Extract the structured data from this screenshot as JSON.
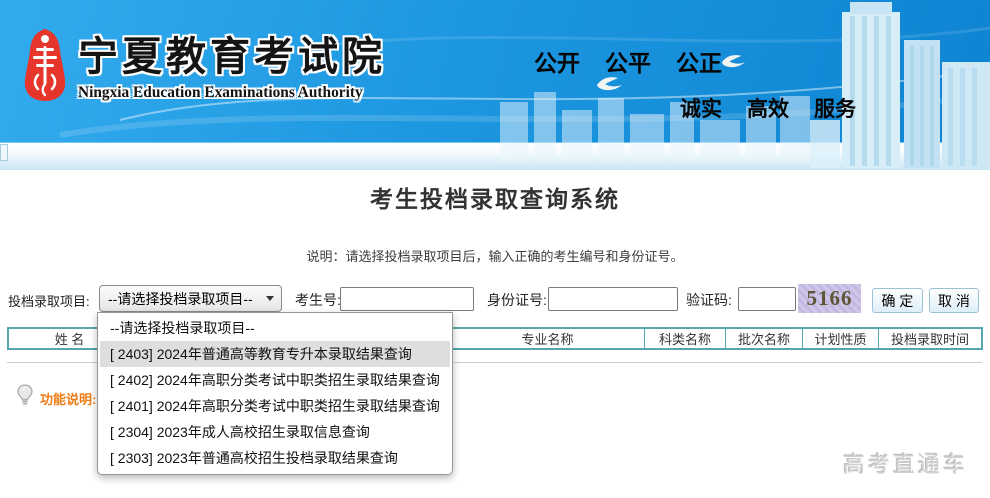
{
  "banner": {
    "org_name_cn": "宁夏教育考试院",
    "org_name_en": "Ningxia Education Examinations Authority",
    "slogan_top": [
      "公开",
      "公平",
      "公正"
    ],
    "slogan_bottom": [
      "诚实",
      "高效",
      "服务"
    ]
  },
  "main": {
    "title": "考生投档录取查询系统",
    "instruction": "说明：请选择投档录取项目后，输入正确的考生编号和身份证号。",
    "note_label": "功能说明:",
    "watermark": "高考直通车"
  },
  "form": {
    "project_label": "投档录取项目:",
    "project_selected": "--请选择投档录取项目--",
    "candidate_no_label": "考生号:",
    "candidate_no_value": "",
    "id_card_label": "身份证号:",
    "id_card_value": "",
    "captcha_label": "验证码:",
    "captcha_input_value": "",
    "captcha_code": "5166",
    "confirm_label": "确 定",
    "cancel_label": "取 消"
  },
  "dropdown": {
    "options": [
      "--请选择投档录取项目--",
      "[ 2403] 2024年普通高等教育专升本录取结果查询",
      "[ 2402] 2024年高职分类考试中职类招生录取结果查询",
      "[ 2401] 2024年高职分类考试中职类招生录取结果查询",
      "[ 2304] 2023年成人高校招生录取信息查询",
      "[ 2303] 2023年普通高校招生投档录取结果查询"
    ],
    "highlighted_option": "[ 2403] 2024年普通高等教育专升本录取结果查询"
  },
  "table": {
    "headers": [
      "姓 名",
      "",
      "专业名称",
      "科类名称",
      "批次名称",
      "计划性质",
      "投档录取时间"
    ]
  },
  "colors": {
    "banner_blue": "#1d97e0",
    "table_border": "#55a6b0",
    "note_orange": "#ef7d15",
    "captcha_bg": "#c9c0e6",
    "captcha_text": "#5e5535"
  }
}
